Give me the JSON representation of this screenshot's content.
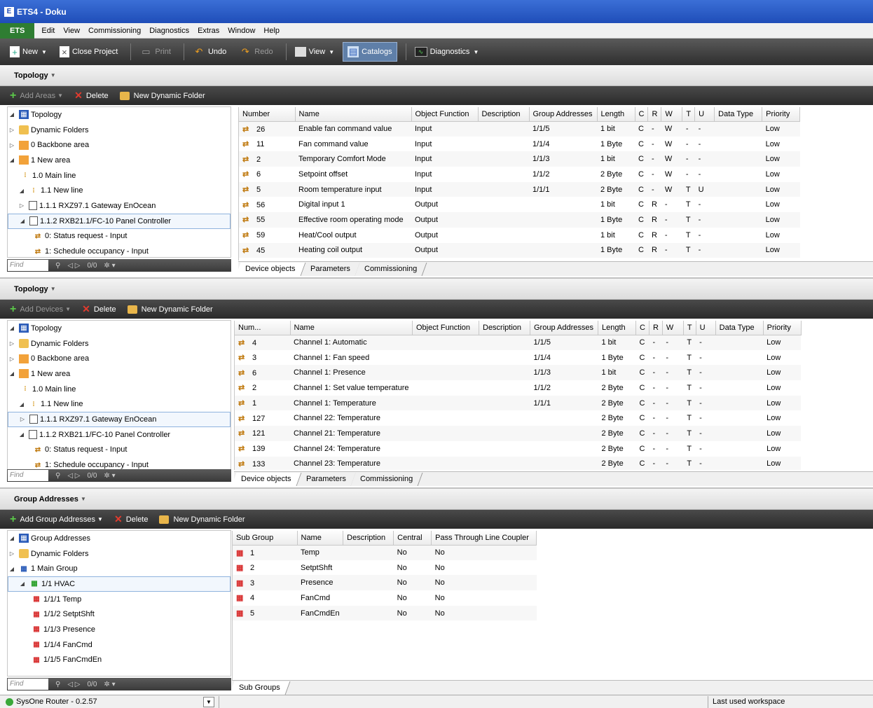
{
  "window": {
    "title": "ETS4 - Doku"
  },
  "menu": [
    "ETS",
    "Edit",
    "View",
    "Commissioning",
    "Diagnostics",
    "Extras",
    "Window",
    "Help"
  ],
  "toolbar": {
    "new": "New",
    "close_project": "Close Project",
    "print": "Print",
    "undo": "Undo",
    "redo": "Redo",
    "view": "View",
    "catalogs": "Catalogs",
    "diagnostics": "Diagnostics"
  },
  "panel1": {
    "title": "Topology",
    "tool": {
      "add": "Add Areas",
      "delete": "Delete",
      "new_folder": "New Dynamic Folder"
    },
    "tree": [
      {
        "label": "Topology",
        "icon": "topology"
      },
      {
        "label": "Dynamic Folders",
        "icon": "folder"
      },
      {
        "label": "0 Backbone area",
        "icon": "area"
      },
      {
        "label": "1 New area",
        "icon": "area"
      },
      {
        "label": "1.0 Main line",
        "icon": "line"
      },
      {
        "label": "1.1 New line",
        "icon": "line"
      },
      {
        "label": "1.1.1  RXZ97.1 Gateway EnOcean",
        "icon": "device"
      },
      {
        "label": "1.1.2  RXB21.1/FC-10 Panel Controller",
        "icon": "device"
      },
      {
        "label": "0: Status request - Input",
        "icon": "object"
      },
      {
        "label": "1: Schedule occupancy - Input",
        "icon": "object"
      }
    ],
    "find": {
      "placeholder": "Find",
      "count": "0/0"
    },
    "columns": [
      "Number",
      "Name",
      "Object Function",
      "Description",
      "Group Addresses",
      "Length",
      "C",
      "R",
      "W",
      "T",
      "U",
      "Data Type",
      "Priority"
    ],
    "rows": [
      [
        "26",
        "Enable fan command value",
        "Input",
        "",
        "1/1/5",
        "1 bit",
        "C",
        "-",
        "W",
        "-",
        "-",
        "",
        "Low"
      ],
      [
        "11",
        "Fan command value",
        "Input",
        "",
        "1/1/4",
        "1 Byte",
        "C",
        "-",
        "W",
        "-",
        "-",
        "",
        "Low"
      ],
      [
        "2",
        "Temporary Comfort Mode",
        "Input",
        "",
        "1/1/3",
        "1 bit",
        "C",
        "-",
        "W",
        "-",
        "-",
        "",
        "Low"
      ],
      [
        "6",
        "Setpoint offset",
        "Input",
        "",
        "1/1/2",
        "2 Byte",
        "C",
        "-",
        "W",
        "-",
        "-",
        "",
        "Low"
      ],
      [
        "5",
        "Room temperature input",
        "Input",
        "",
        "1/1/1",
        "2 Byte",
        "C",
        "-",
        "W",
        "T",
        "U",
        "",
        "Low"
      ],
      [
        "56",
        "Digital input 1",
        "Output",
        "",
        "",
        "1 bit",
        "C",
        "R",
        "-",
        "T",
        "-",
        "",
        "Low"
      ],
      [
        "55",
        "Effective room operating mode",
        "Output",
        "",
        "",
        "1 Byte",
        "C",
        "R",
        "-",
        "T",
        "-",
        "",
        "Low"
      ],
      [
        "59",
        "Heat/Cool output",
        "Output",
        "",
        "",
        "1 bit",
        "C",
        "R",
        "-",
        "T",
        "-",
        "",
        "Low"
      ],
      [
        "45",
        "Heating coil output",
        "Output",
        "",
        "",
        "1 Byte",
        "C",
        "R",
        "-",
        "T",
        "-",
        "",
        "Low"
      ]
    ],
    "tabs": [
      "Device objects",
      "Parameters",
      "Commissioning"
    ]
  },
  "panel2": {
    "title": "Topology",
    "tool": {
      "add": "Add Devices",
      "delete": "Delete",
      "new_folder": "New Dynamic Folder"
    },
    "tree": [
      {
        "label": "Topology"
      },
      {
        "label": "Dynamic Folders"
      },
      {
        "label": "0 Backbone area"
      },
      {
        "label": "1 New area"
      },
      {
        "label": "1.0 Main line"
      },
      {
        "label": "1.1 New line"
      },
      {
        "label": "1.1.1  RXZ97.1 Gateway EnOcean"
      },
      {
        "label": "1.1.2  RXB21.1/FC-10 Panel Controller"
      },
      {
        "label": "0: Status request - Input"
      },
      {
        "label": "1: Schedule occupancy - Input"
      }
    ],
    "find": {
      "placeholder": "Find",
      "count": "0/0"
    },
    "columns": [
      "Num...",
      "Name",
      "Object Function",
      "Description",
      "Group Addresses",
      "Length",
      "C",
      "R",
      "W",
      "T",
      "U",
      "Data Type",
      "Priority"
    ],
    "rows": [
      [
        "4",
        "Channel 1: Automatic",
        "",
        "",
        "1/1/5",
        "1 bit",
        "C",
        "-",
        "-",
        "T",
        "-",
        "",
        "Low"
      ],
      [
        "3",
        "Channel 1: Fan speed",
        "",
        "",
        "1/1/4",
        "1 Byte",
        "C",
        "-",
        "-",
        "T",
        "-",
        "",
        "Low"
      ],
      [
        "6",
        "Channel 1: Presence",
        "",
        "",
        "1/1/3",
        "1 bit",
        "C",
        "-",
        "-",
        "T",
        "-",
        "",
        "Low"
      ],
      [
        "2",
        "Channel 1: Set value temperature",
        "",
        "",
        "1/1/2",
        "2 Byte",
        "C",
        "-",
        "-",
        "T",
        "-",
        "",
        "Low"
      ],
      [
        "1",
        "Channel 1: Temperature",
        "",
        "",
        "1/1/1",
        "2 Byte",
        "C",
        "-",
        "-",
        "T",
        "-",
        "",
        "Low"
      ],
      [
        "127",
        "Channel 22: Temperature",
        "",
        "",
        "",
        "2 Byte",
        "C",
        "-",
        "-",
        "T",
        "-",
        "",
        "Low"
      ],
      [
        "121",
        "Channel 21: Temperature",
        "",
        "",
        "",
        "2 Byte",
        "C",
        "-",
        "-",
        "T",
        "-",
        "",
        "Low"
      ],
      [
        "139",
        "Channel 24: Temperature",
        "",
        "",
        "",
        "2 Byte",
        "C",
        "-",
        "-",
        "T",
        "-",
        "",
        "Low"
      ],
      [
        "133",
        "Channel 23: Temperature",
        "",
        "",
        "",
        "2 Byte",
        "C",
        "-",
        "-",
        "T",
        "-",
        "",
        "Low"
      ]
    ],
    "tabs": [
      "Device objects",
      "Parameters",
      "Commissioning"
    ]
  },
  "panel3": {
    "title": "Group Addresses",
    "tool": {
      "add": "Add Group Addresses",
      "delete": "Delete",
      "new_folder": "New Dynamic Folder"
    },
    "tree": [
      {
        "label": "Group Addresses"
      },
      {
        "label": "Dynamic Folders"
      },
      {
        "label": "1 Main Group"
      },
      {
        "label": "1/1 HVAC"
      },
      {
        "label": "1/1/1 Temp"
      },
      {
        "label": "1/1/2 SetptShft"
      },
      {
        "label": "1/1/3 Presence"
      },
      {
        "label": "1/1/4 FanCmd"
      },
      {
        "label": "1/1/5 FanCmdEn"
      }
    ],
    "find": {
      "placeholder": "Find",
      "count": "0/0"
    },
    "columns": [
      "Sub Group",
      "Name",
      "Description",
      "Central",
      "Pass Through Line Coupler"
    ],
    "rows": [
      [
        "1",
        "Temp",
        "",
        "No",
        "No"
      ],
      [
        "2",
        "SetptShft",
        "",
        "No",
        "No"
      ],
      [
        "3",
        "Presence",
        "",
        "No",
        "No"
      ],
      [
        "4",
        "FanCmd",
        "",
        "No",
        "No"
      ],
      [
        "5",
        "FanCmdEn",
        "",
        "No",
        "No"
      ]
    ],
    "tabs": [
      "Sub Groups"
    ]
  },
  "status": {
    "connection": "SysOne Router - 0.2.57",
    "workspace": "Last used workspace"
  }
}
